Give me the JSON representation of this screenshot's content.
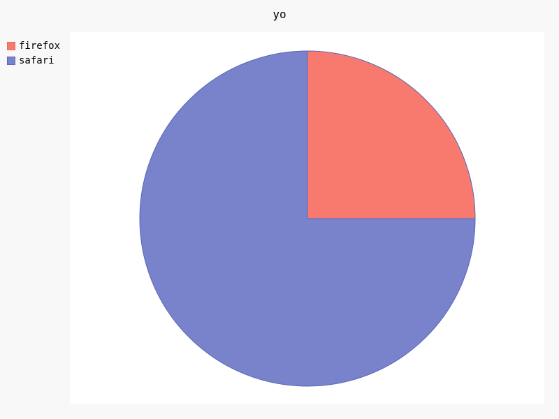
{
  "chart_data": {
    "type": "pie",
    "title": "yo",
    "legend_position": "top-left",
    "series": [
      {
        "name": "firefox",
        "value": 25,
        "color": "#f87a6f",
        "stroke": "#e36b61"
      },
      {
        "name": "safari",
        "value": 75,
        "color": "#7883cc",
        "stroke": "#5a66b8"
      }
    ]
  }
}
